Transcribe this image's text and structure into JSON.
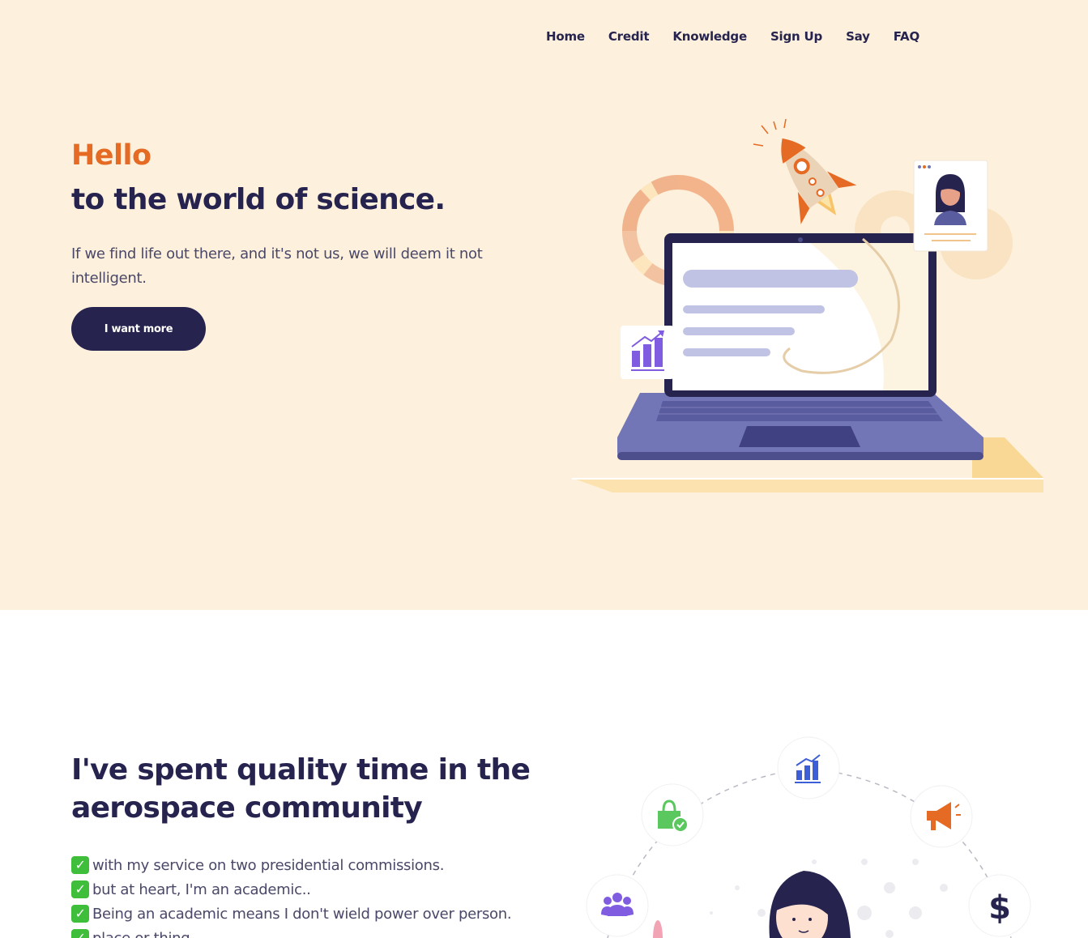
{
  "nav": {
    "items": [
      "Home",
      "Credit",
      "Knowledge",
      "Sign Up",
      "Say",
      "FAQ"
    ]
  },
  "hero": {
    "greeting": "Hello",
    "headline": "to the world of science.",
    "lead": "If we find life out there, and it's not us, we will deem it not intelligent.",
    "cta_label": "I want more"
  },
  "section2": {
    "title": "I've spent quality time in the aerospace community",
    "bullets": [
      "with my service on two presidential commissions.",
      "but at heart, I'm an academic..",
      "Being an academic means I don't wield power over person.",
      "place or thing."
    ],
    "icons": [
      "people-icon",
      "shopping-bag-icon",
      "bar-chart-icon",
      "megaphone-icon",
      "dollar-icon"
    ],
    "dollar_symbol": "$"
  },
  "colors": {
    "hero_bg": "#fdf0dc",
    "accent_orange": "#e56a24",
    "navy": "#26244f",
    "text_muted": "#4a4868",
    "laptop_purple": "#7376b6",
    "check_green": "#3ebe3a"
  }
}
